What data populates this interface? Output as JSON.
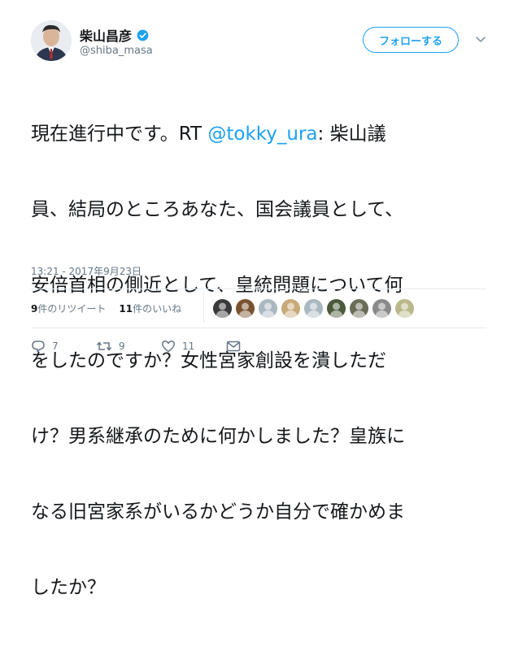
{
  "author": {
    "display_name": "柴山昌彦",
    "handle": "@shiba_masa",
    "verified": true
  },
  "follow_button_label": "フォローする",
  "tweet": {
    "lines": [
      {
        "pre": "現在進行中です。RT ",
        "mention": "@tokky_ura",
        "post": ": 柴山議"
      },
      {
        "text": "員、結局のところあなた、国会議員として、"
      },
      {
        "text": "安倍首相の側近として、皇統問題について何"
      },
      {
        "text": "をしたのですか？女性宮家創設を潰しただ"
      },
      {
        "text": "け？男系継承のために何かしました？皇族に"
      },
      {
        "text": "なる旧宮家系がいるかどうか自分で確かめま"
      },
      {
        "text": "したか？"
      }
    ],
    "timestamp": "13:21 - 2017年9月23日"
  },
  "stats": {
    "retweets_count": "9",
    "retweets_label": "件のリツイート",
    "likes_count": "11",
    "likes_label": "件のいいね"
  },
  "actions": {
    "reply_count": "7",
    "retweet_count": "9",
    "like_count": "11"
  },
  "colors": {
    "accent": "#1da1f2",
    "text": "#14171a",
    "muted": "#657786",
    "divider": "#e6ecf0"
  },
  "likers": [
    {
      "icon": "liker-avatar-1",
      "color": "#3a3a3a"
    },
    {
      "icon": "liker-avatar-2",
      "color": "#7a5230"
    },
    {
      "icon": "liker-avatar-3",
      "color": "#aab8c2"
    },
    {
      "icon": "liker-avatar-4",
      "color": "#c9a978"
    },
    {
      "icon": "liker-avatar-5",
      "color": "#aab8c2"
    },
    {
      "icon": "liker-avatar-6",
      "color": "#4a5a3a"
    },
    {
      "icon": "liker-avatar-7",
      "color": "#6b6b5a"
    },
    {
      "icon": "liker-avatar-8",
      "color": "#8a8a8a"
    },
    {
      "icon": "liker-avatar-9",
      "color": "#b8b88a"
    }
  ]
}
